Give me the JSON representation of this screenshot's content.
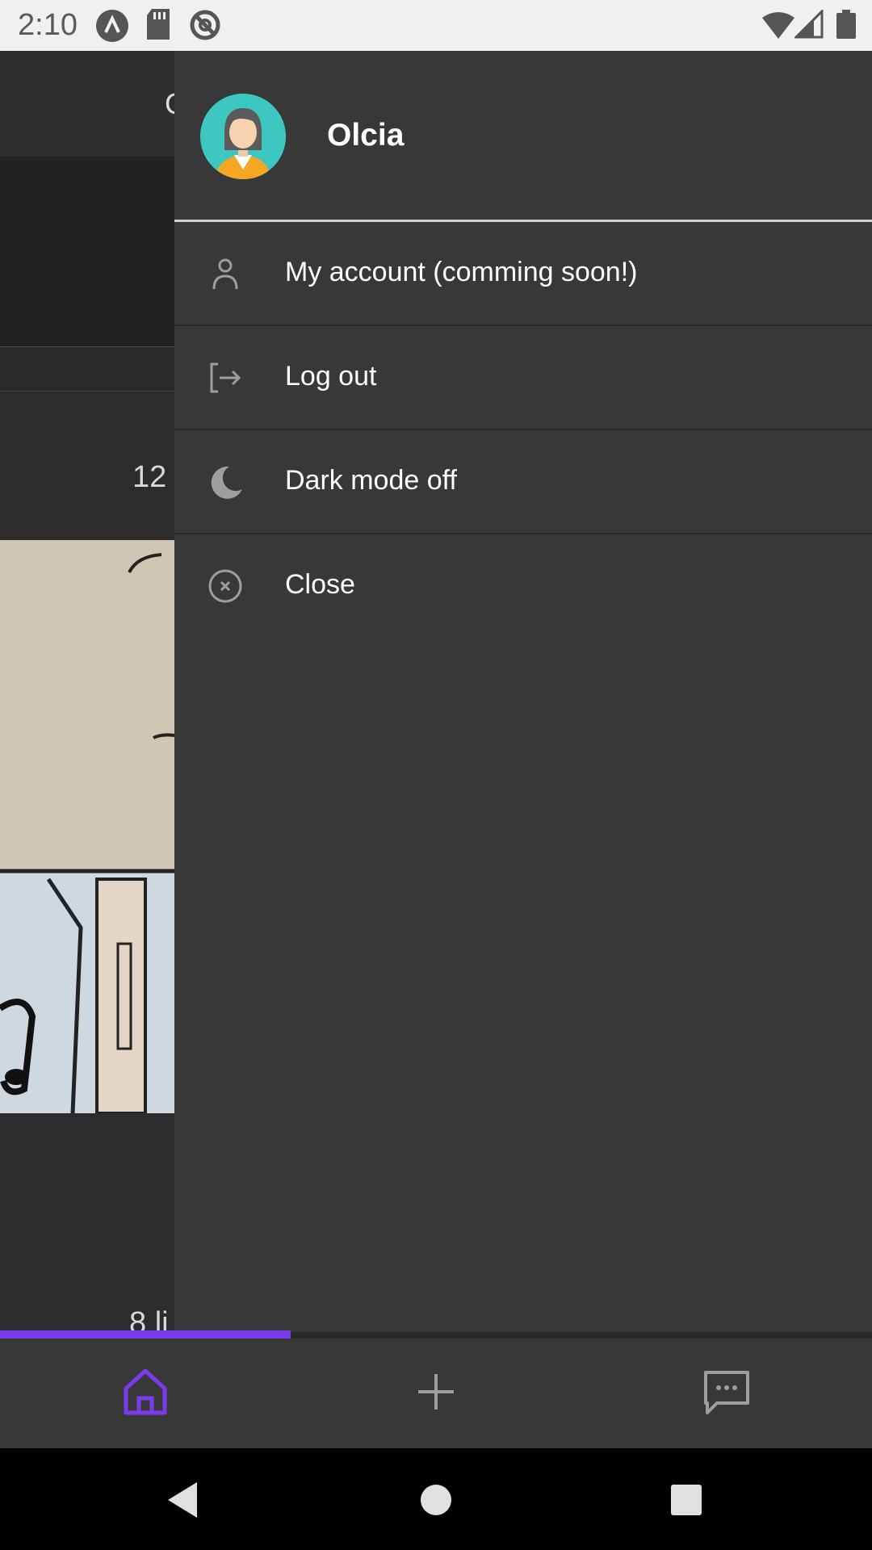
{
  "status_bar": {
    "time": "2:10",
    "left_icons": [
      "app-notification-icon",
      "sd-card-icon",
      "do-not-disturb-icon"
    ],
    "right_icons": [
      "wifi-icon",
      "cell-signal-icon",
      "battery-icon"
    ]
  },
  "background_screen": {
    "header_partial_text": "C",
    "comment_count": "12",
    "likes_partial_text": "8 li"
  },
  "drawer": {
    "user_name": "Olcia",
    "avatar_icon": "user-avatar-icon",
    "menu": [
      {
        "label": "My account (comming soon!)",
        "icon": "person-icon"
      },
      {
        "label": "Log out",
        "icon": "logout-icon"
      },
      {
        "label": "Dark mode off",
        "icon": "moon-icon"
      },
      {
        "label": "Close",
        "icon": "close-circle-icon"
      }
    ]
  },
  "bottom_nav": {
    "items": [
      {
        "icon": "home-icon",
        "active": true
      },
      {
        "icon": "plus-icon",
        "active": false
      },
      {
        "icon": "chat-icon",
        "active": false
      }
    ],
    "progress_fraction": 0.333
  },
  "colors": {
    "accent": "#7c3aed",
    "drawer_bg": "#383838",
    "status_bar_bg": "#f0f0f0",
    "icon_gray": "#9e9e9e"
  }
}
